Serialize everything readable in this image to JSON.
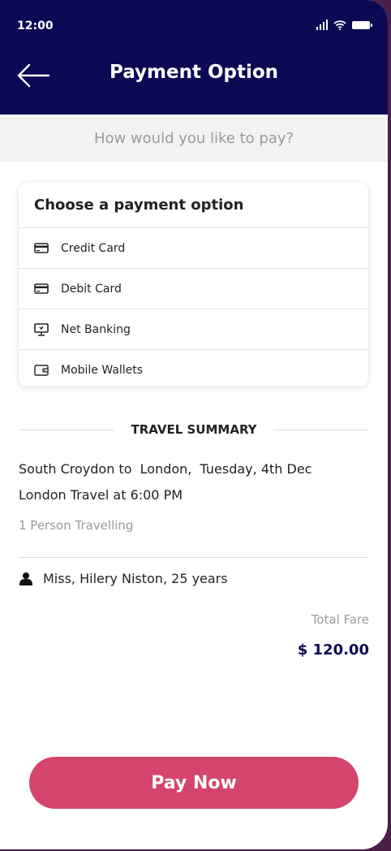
{
  "status_bar": {
    "time": "12:00"
  },
  "header": {
    "title": "Payment Option",
    "back_icon": "arrow-left-icon"
  },
  "subheader": {
    "prompt": "How would you like to pay?"
  },
  "payment_card": {
    "title": "Choose a payment option",
    "options": [
      {
        "label": "Credit Card",
        "icon": "card-icon"
      },
      {
        "label": "Debit Card",
        "icon": "card-icon"
      },
      {
        "label": "Net Banking",
        "icon": "monitor-icon"
      },
      {
        "label": "Mobile Wallets",
        "icon": "wallet-icon"
      }
    ]
  },
  "summary": {
    "heading": "TRAVEL SUMMARY",
    "route_line": "South Croydon to  London,  Tuesday, 4th Dec",
    "time_line": "London Travel at 6:00 PM",
    "persons": "1 Person Travelling",
    "passenger": "Miss, Hilery Niston, 25 years",
    "fare_label": "Total Fare",
    "fare_value": "$ 120.00"
  },
  "actions": {
    "pay_label": "Pay Now"
  },
  "colors": {
    "header_bg": "#0c0a55",
    "accent": "#d3456c",
    "fare": "#0c0a55"
  }
}
